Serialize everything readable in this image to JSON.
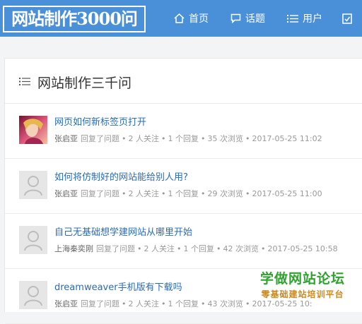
{
  "header": {
    "logo_text": "网站制作3000问",
    "nav": [
      {
        "label": "首页",
        "icon": "home-icon"
      },
      {
        "label": "话题",
        "icon": "chat-bubble-icon"
      },
      {
        "label": "用户",
        "icon": "list-icon"
      },
      {
        "label": "",
        "icon": "edit-check-icon"
      }
    ],
    "background_color": "#4a90d9"
  },
  "panel": {
    "title": "网站制作三千问",
    "icon": "list-icon"
  },
  "questions": [
    {
      "title": "网页如何新标签页打开",
      "author": "张启亚",
      "action": "回复了问题",
      "follows": "2 人关注",
      "replies": "1 个回复",
      "views": "35 次浏览",
      "time": "2017-05-25 11:02",
      "avatar": "photo-avatar"
    },
    {
      "title": "如何将仿制好的网站能给别人用?",
      "author": "张启亚",
      "action": "回复了问题",
      "follows": "2 人关注",
      "replies": "1 个回复",
      "views": "29 次浏览",
      "time": "2017-05-25 11:00",
      "avatar": "default-user-avatar"
    },
    {
      "title": "自己无基础想学建网站从哪里开始",
      "author": "上海秦奕刚",
      "action": "回复了问题",
      "follows": "2 人关注",
      "replies": "1 个回复",
      "views": "42 次浏览",
      "time": "2017-05-25 10:58",
      "avatar": "default-user-avatar"
    },
    {
      "title": "dreamweaver手机版有下载吗",
      "author": "张启亚",
      "action": "回复了问题",
      "follows": "2 人关注",
      "replies": "1 个回复",
      "views": "43 次浏览",
      "time": "2017-05-25 10:",
      "avatar": "default-user-avatar"
    }
  ],
  "watermark": {
    "title": "学做网站论坛",
    "subtitle": "零基础建站培训平台"
  },
  "colors": {
    "link": "#2a6bb8",
    "meta": "#999999",
    "watermark_green": "#2ea32e",
    "watermark_orange": "#d0881a"
  }
}
